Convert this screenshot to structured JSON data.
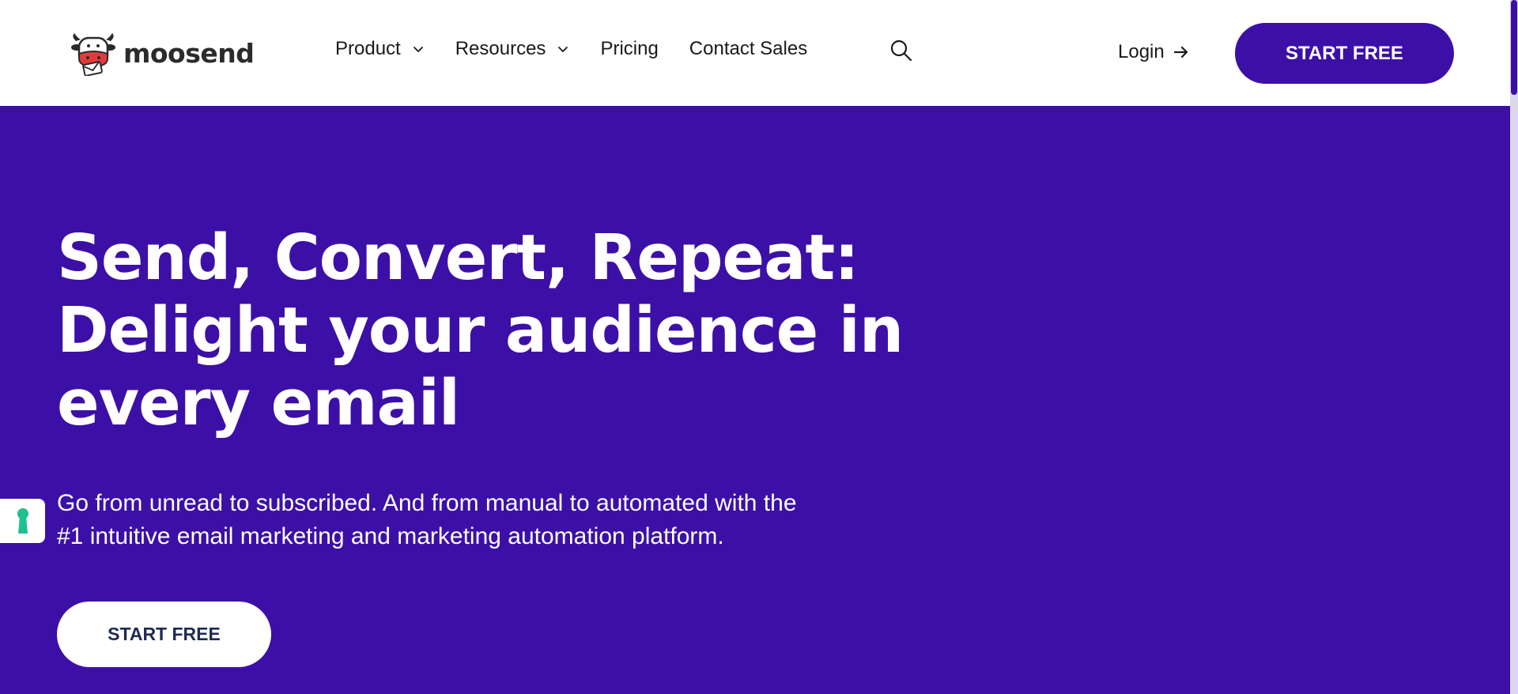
{
  "brand": {
    "name": "moosend",
    "logo_icon": "cow-logo-icon",
    "accent_color": "#3c10a6"
  },
  "nav": {
    "items": [
      {
        "label": "Product",
        "has_dropdown": true
      },
      {
        "label": "Resources",
        "has_dropdown": true
      },
      {
        "label": "Pricing",
        "has_dropdown": false
      },
      {
        "label": "Contact Sales",
        "has_dropdown": false
      }
    ],
    "search_icon": "search-icon",
    "login_label": "Login",
    "cta_label": "START FREE"
  },
  "hero": {
    "title_lines": [
      "Send, Convert, Repeat:",
      "Delight your audience in",
      "every email"
    ],
    "subtitle_lines": [
      "Go from unread to subscribed. And from manual to automated with the",
      "#1 intuitive email marketing and marketing automation platform."
    ],
    "cta_label": "START FREE",
    "background_color": "#3c10a6"
  },
  "side_tab": {
    "icon": "keyhole-icon",
    "icon_color": "#1fbf8f"
  }
}
